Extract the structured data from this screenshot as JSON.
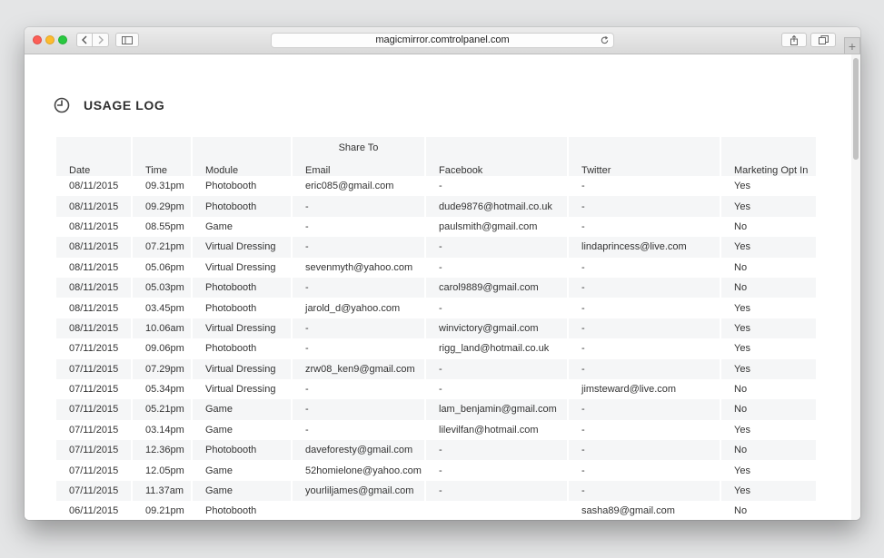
{
  "browser": {
    "url": "magicmirror.comtrolpanel.com"
  },
  "page": {
    "title": "USAGE LOG"
  },
  "table": {
    "group_header": "Share To",
    "columns": [
      "Date",
      "Time",
      "Module",
      "Email",
      "Facebook",
      "Twitter",
      "Marketing Opt In"
    ],
    "rows": [
      [
        "08/11/2015",
        "09.31pm",
        "Photobooth",
        "eric085@gmail.com",
        "-",
        "-",
        "Yes"
      ],
      [
        "08/11/2015",
        "09.29pm",
        "Photobooth",
        "-",
        "dude9876@hotmail.co.uk",
        "-",
        "Yes"
      ],
      [
        "08/11/2015",
        "08.55pm",
        "Game",
        "-",
        "paulsmith@gmail.com",
        "-",
        "No"
      ],
      [
        "08/11/2015",
        "07.21pm",
        "Virtual Dressing",
        "-",
        "-",
        "lindaprincess@live.com",
        "Yes"
      ],
      [
        "08/11/2015",
        "05.06pm",
        "Virtual Dressing",
        "sevenmyth@yahoo.com",
        "-",
        "-",
        "No"
      ],
      [
        "08/11/2015",
        "05.03pm",
        "Photobooth",
        "-",
        "carol9889@gmail.com",
        "-",
        "No"
      ],
      [
        "08/11/2015",
        "03.45pm",
        "Photobooth",
        "jarold_d@yahoo.com",
        "-",
        "-",
        "Yes"
      ],
      [
        "08/11/2015",
        "10.06am",
        "Virtual Dressing",
        "-",
        "winvictory@gmail.com",
        "-",
        "Yes"
      ],
      [
        "07/11/2015",
        "09.06pm",
        "Photobooth",
        "-",
        "rigg_land@hotmail.co.uk",
        "-",
        "Yes"
      ],
      [
        "07/11/2015",
        "07.29pm",
        "Virtual Dressing",
        "zrw08_ken9@gmail.com",
        "-",
        "-",
        "Yes"
      ],
      [
        "07/11/2015",
        "05.34pm",
        "Virtual Dressing",
        "-",
        "-",
        "jimsteward@live.com",
        "No"
      ],
      [
        "07/11/2015",
        "05.21pm",
        "Game",
        "-",
        "lam_benjamin@gmail.com",
        "-",
        "No"
      ],
      [
        "07/11/2015",
        "03.14pm",
        "Game",
        "-",
        "lilevilfan@hotmail.com",
        "-",
        "Yes"
      ],
      [
        "07/11/2015",
        "12.36pm",
        "Photobooth",
        "daveforesty@gmail.com",
        "-",
        "-",
        "No"
      ],
      [
        "07/11/2015",
        "12.05pm",
        "Game",
        "52homielone@yahoo.com",
        "-",
        "-",
        "Yes"
      ],
      [
        "07/11/2015",
        "11.37am",
        "Game",
        "yourliljames@gmail.com",
        "-",
        "-",
        "Yes"
      ],
      [
        "06/11/2015",
        "09.21pm",
        "Photobooth",
        "",
        "",
        "sasha89@gmail.com",
        "No"
      ]
    ]
  },
  "icons": {
    "page_icon": "clock-icon",
    "reload": "reload-icon",
    "share": "share-icon",
    "tabs": "tabs-icon",
    "sidebar": "sidebar-icon",
    "new_tab": "plus-icon"
  }
}
